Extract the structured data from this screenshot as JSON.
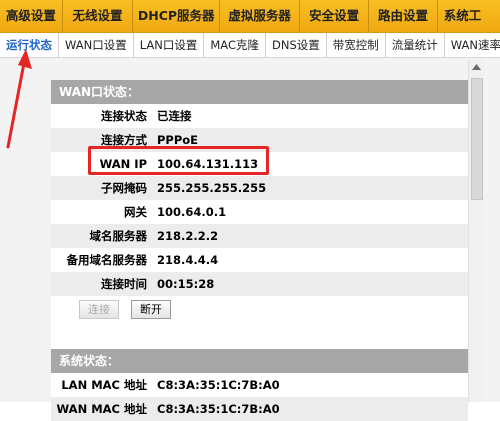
{
  "top_menu": [
    "高级设置",
    "无线设置",
    "DHCP服务器",
    "虚拟服务器",
    "安全设置",
    "路由设置",
    "系统工"
  ],
  "sub_menu": [
    "运行状态",
    "WAN口设置",
    "LAN口设置",
    "MAC克隆",
    "DNS设置",
    "带宽控制",
    "流量统计",
    "WAN速率控制"
  ],
  "wan_section": {
    "title": "WAN口状态：",
    "rows": [
      {
        "label": "连接状态",
        "value": "已连接"
      },
      {
        "label": "连接方式",
        "value": "PPPoE"
      },
      {
        "label": "WAN IP",
        "value": "100.64.131.113"
      },
      {
        "label": "子网掩码",
        "value": "255.255.255.255"
      },
      {
        "label": "网关",
        "value": "100.64.0.1"
      },
      {
        "label": "域名服务器",
        "value": "218.2.2.2"
      },
      {
        "label": "备用域名服务器",
        "value": "218.4.4.4"
      },
      {
        "label": "连接时间",
        "value": "00:15:28"
      }
    ],
    "buttons": {
      "connect": "连接",
      "disconnect": "断开"
    }
  },
  "sys_section": {
    "title": "系统状态：",
    "rows": [
      {
        "label": "LAN MAC 地址",
        "value": "C8:3A:35:1C:7B:A0"
      },
      {
        "label": "WAN MAC 地址",
        "value": "C8:3A:35:1C:7B:A0"
      }
    ]
  },
  "colors": {
    "accent": "#f1a812",
    "highlight": "#e52626",
    "active_tab": "#1f64c8"
  }
}
